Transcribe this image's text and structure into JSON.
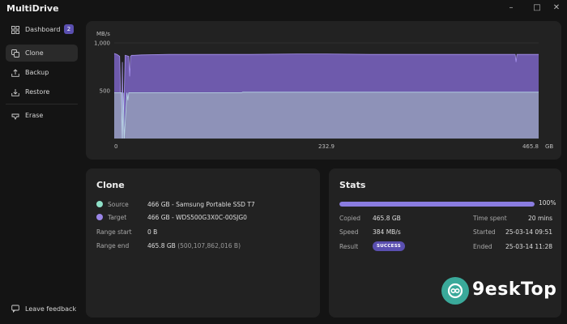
{
  "app": {
    "title": "MultiDrive",
    "window_controls": [
      "minimize",
      "maximize",
      "close"
    ]
  },
  "sidebar": {
    "items": [
      {
        "label": "Dashboard",
        "icon": "grid-icon",
        "badge": "2",
        "active": false
      },
      {
        "label": "Clone",
        "icon": "copy-icon",
        "active": true
      },
      {
        "label": "Backup",
        "icon": "upload-tray-icon",
        "active": false
      },
      {
        "label": "Restore",
        "icon": "download-tray-icon",
        "active": false
      },
      {
        "label": "Erase",
        "icon": "eraser-icon",
        "active": false
      }
    ],
    "feedback_label": "Leave feedback"
  },
  "chart": {
    "unit_label": "MB/s",
    "y_ticks": [
      "1,000",
      "500"
    ],
    "x_ticks": [
      "0",
      "232.9",
      "465.8"
    ],
    "x_unit": "GB"
  },
  "chart_data": {
    "type": "area",
    "xlabel": "GB",
    "ylabel": "MB/s",
    "xlim": [
      0,
      465.8
    ],
    "ylim": [
      0,
      1000
    ],
    "series": [
      {
        "color": "#7b64c4",
        "x": [
          0,
          3,
          6,
          8,
          9,
          10,
          12,
          16,
          17,
          18,
          19,
          22,
          30,
          60,
          100,
          150,
          200,
          233,
          280,
          330,
          380,
          420,
          440,
          441,
          442,
          450,
          465.8
        ],
        "values": [
          890,
          880,
          860,
          0,
          800,
          0,
          870,
          860,
          650,
          860,
          870,
          870,
          875,
          880,
          880,
          880,
          885,
          885,
          880,
          880,
          880,
          880,
          880,
          800,
          880,
          880,
          880
        ]
      },
      {
        "color": "#9aa6bc",
        "x": [
          0,
          8,
          9,
          10,
          11,
          14,
          15,
          16,
          20,
          60,
          100,
          140,
          141,
          200,
          233,
          300,
          380,
          465.8
        ],
        "values": [
          480,
          480,
          0,
          480,
          0,
          480,
          400,
          480,
          480,
          480,
          480,
          480,
          485,
          485,
          485,
          485,
          485,
          485
        ]
      }
    ]
  },
  "clone": {
    "title": "Clone",
    "source_label": "Source",
    "source_value": "466 GB - Samsung Portable SSD T7",
    "source_color": "#8fe0c8",
    "target_label": "Target",
    "target_value": "466 GB - WDS500G3X0C-00SJG0",
    "target_color": "#9b86e8",
    "range_start_label": "Range start",
    "range_start_value": "0 B",
    "range_end_label": "Range end",
    "range_end_value": "465.8 GB",
    "range_end_bytes": "(500,107,862,016 B)"
  },
  "stats": {
    "title": "Stats",
    "progress": 100,
    "progress_label": "100%",
    "copied_label": "Copied",
    "copied_value": "465.8 GB",
    "speed_label": "Speed",
    "speed_value": "384 MB/s",
    "result_label": "Result",
    "result_value": "SUCCESS",
    "time_spent_label": "Time spent",
    "time_spent_value": "20 mins",
    "started_label": "Started",
    "started_value": "25-03-14 09:51",
    "ended_label": "Ended",
    "ended_value": "25-03-14 11:28"
  },
  "watermark": {
    "text": "9eskTop"
  }
}
